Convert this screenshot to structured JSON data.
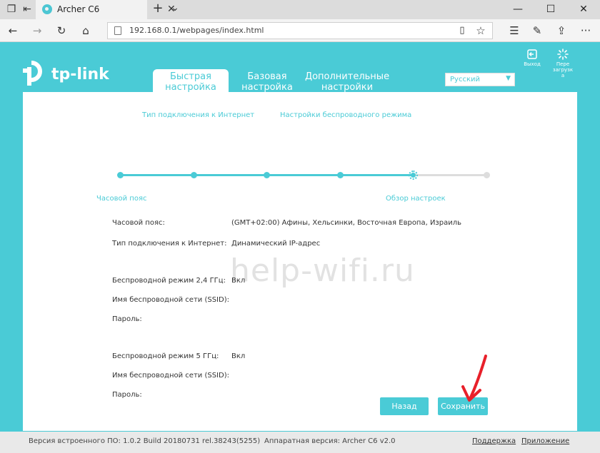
{
  "browser": {
    "tab_title": "Archer C6",
    "tab_close": "✕",
    "new_tab": "+",
    "tab_list": "⌄",
    "url": "192.168.0.1/webpages/index.html",
    "win_minimize": "—",
    "win_maximize": "☐",
    "win_close": "✕"
  },
  "header": {
    "logo_text": "tp-link",
    "tabs": [
      {
        "label": "Быстрая\nнастройка",
        "active": true
      },
      {
        "label": "Базовая\nнастройка",
        "active": false
      },
      {
        "label": "Дополнительные\nнастройки",
        "active": false
      }
    ],
    "language": "Русский",
    "logout_label": "Выход",
    "reboot_label": "Пере\nзагрузк\nа"
  },
  "steps": {
    "top_labels": [
      "Тип подключения к Интернет",
      "Настройки беспроводного режима"
    ],
    "bottom_labels": [
      "Часовой пояс",
      "Обзор настроек"
    ]
  },
  "summary": {
    "rows": [
      {
        "label": "Часовой пояс:",
        "value": "(GMT+02:00) Афины, Хельсинки, Восточная Европа, Израиль"
      },
      {
        "label": "Тип подключения к Интернет:",
        "value": "Динамический IP-адрес"
      },
      {
        "label": "Беспроводной режим 2,4 ГГц:",
        "value": "Вкл"
      },
      {
        "label": "Имя беспроводной сети (SSID):",
        "value": ""
      },
      {
        "label": "Пароль:",
        "value": ""
      },
      {
        "label": "Беспроводной режим 5 ГГц:",
        "value": "Вкл"
      },
      {
        "label": "Имя беспроводной сети (SSID):",
        "value": ""
      },
      {
        "label": "Пароль:",
        "value": ""
      }
    ]
  },
  "watermark": "help-wifi.ru",
  "buttons": {
    "back": "Назад",
    "save": "Сохранить"
  },
  "footer": {
    "firmware": "Версия встроенного ПО: 1.0.2 Build 20180731 rel.38243(5255)",
    "hardware": "Аппаратная версия: Archer C6 v2.0",
    "support": "Поддержка",
    "app": "Приложение"
  },
  "colors": {
    "accent": "#4acbd6",
    "arrow": "#e8202a"
  }
}
